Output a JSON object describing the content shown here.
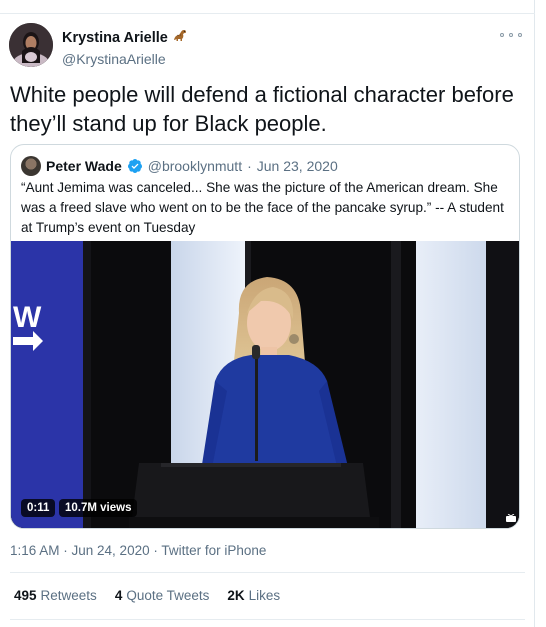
{
  "author": {
    "name": "Krystina Arielle",
    "handle": "@KrystinaArielle"
  },
  "tweet": {
    "text": "White people will defend a fictional character before they’ll stand up for Black people."
  },
  "quoted": {
    "name": "Peter Wade",
    "handle": "@brooklynmutt",
    "separator": "·",
    "date": "Jun 23, 2020",
    "text": "“Aunt Jemima was canceled... She was the picture of the American dream. She was a freed slave who went on to be the face of the pancake syrup.” -- A student at Trump’s event on Tuesday",
    "video": {
      "duration": "0:11",
      "views": "10.7M views",
      "sign_text": "W"
    }
  },
  "meta": {
    "time": "1:16 AM · Jun 24, 2020 · Twitter for iPhone"
  },
  "stats": {
    "retweets_count": "495",
    "retweets_label": "Retweets",
    "quotes_count": "4",
    "quotes_label": "Quote Tweets",
    "likes_count": "2K",
    "likes_label": "Likes"
  },
  "colors": {
    "verified": "#1da1f2",
    "muted": "#5b7083",
    "stage_blue": "#2b34a8",
    "dress_blue": "#1f3aa0"
  },
  "icons": {
    "author_emoji": "dinosaur-emoji-icon",
    "more": "more-icon",
    "verified": "verified-badge-icon"
  }
}
